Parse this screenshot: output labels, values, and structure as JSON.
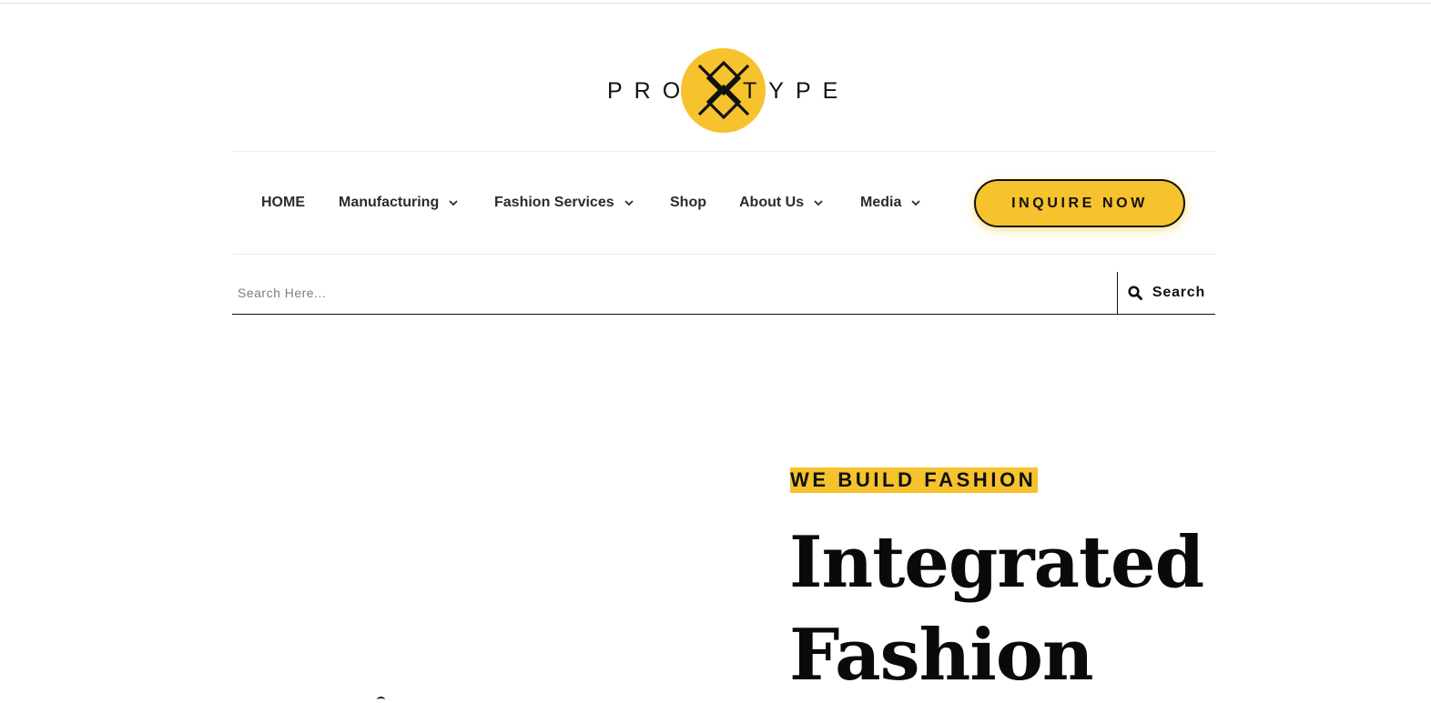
{
  "brand": {
    "logo_left": "PROT",
    "logo_right": "TYPE",
    "logo_icon": "prototype-x-mark-icon",
    "accent_color": "#f6c22d"
  },
  "nav": {
    "items": [
      {
        "label": "HOME",
        "has_dropdown": false
      },
      {
        "label": "Manufacturing",
        "has_dropdown": true
      },
      {
        "label": "Fashion Services",
        "has_dropdown": true
      },
      {
        "label": "Shop",
        "has_dropdown": false
      },
      {
        "label": "About Us",
        "has_dropdown": true
      },
      {
        "label": "Media",
        "has_dropdown": true
      }
    ],
    "cta_label": "INQUIRE NOW"
  },
  "search": {
    "placeholder": "Search Here...",
    "value": "",
    "button_label": "Search",
    "button_icon": "search-icon"
  },
  "hero": {
    "eyebrow": "WE BUILD FASHION",
    "title_lines": [
      "Integrated",
      "Fashion"
    ]
  }
}
